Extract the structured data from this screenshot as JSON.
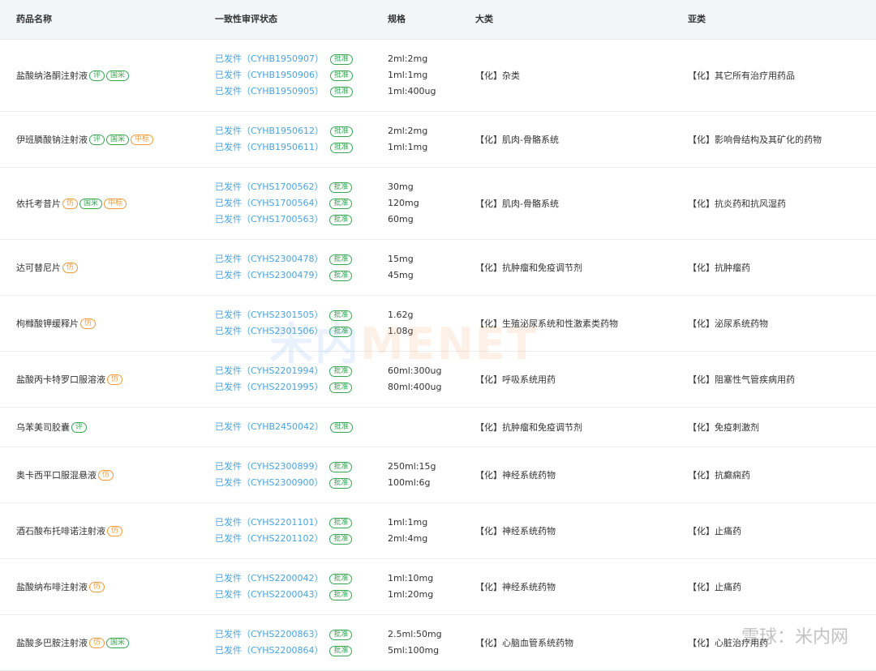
{
  "headers": {
    "name": "药品名称",
    "status": "一致性审评状态",
    "spec": "规格",
    "category": "大类",
    "subcategory": "亚类"
  },
  "rows": [
    {
      "name": "盐酸纳洛酮注射液",
      "tags": [
        {
          "text": "评",
          "color": "green"
        },
        {
          "text": "国采",
          "color": "green"
        }
      ],
      "statuses": [
        "已发件（CYHB1950907）",
        "已发件（CYHB1950906）",
        "已发件（CYHB1950905）"
      ],
      "specs": [
        "2ml:2mg",
        "1ml:1mg",
        "1ml:400ug"
      ],
      "category": "【化】杂类",
      "subcategory": "【化】其它所有治疗用药品"
    },
    {
      "name": "伊班膦酸钠注射液",
      "tags": [
        {
          "text": "评",
          "color": "green"
        },
        {
          "text": "国采",
          "color": "green"
        },
        {
          "text": "中标",
          "color": "orange"
        }
      ],
      "statuses": [
        "已发件（CYHB1950612）",
        "已发件（CYHB1950611）"
      ],
      "specs": [
        "2ml:2mg",
        "1ml:1mg"
      ],
      "category": "【化】肌肉-骨骼系统",
      "subcategory": "【化】影响骨结构及其矿化的药物"
    },
    {
      "name": "依托考昔片",
      "tags": [
        {
          "text": "仿",
          "color": "orange"
        },
        {
          "text": "国采",
          "color": "green"
        },
        {
          "text": "中标",
          "color": "orange"
        }
      ],
      "statuses": [
        "已发件（CYHS1700562）",
        "已发件（CYHS1700564）",
        "已发件（CYHS1700563）"
      ],
      "specs": [
        "30mg",
        "120mg",
        "60mg"
      ],
      "category": "【化】肌肉-骨骼系统",
      "subcategory": "【化】抗炎药和抗风湿药"
    },
    {
      "name": "达可替尼片",
      "tags": [
        {
          "text": "仿",
          "color": "orange"
        }
      ],
      "statuses": [
        "已发件（CYHS2300478）",
        "已发件（CYHS2300479）"
      ],
      "specs": [
        "15mg",
        "45mg"
      ],
      "category": "【化】抗肿瘤和免疫调节剂",
      "subcategory": "【化】抗肿瘤药"
    },
    {
      "name": "枸橼酸钾缓释片",
      "tags": [
        {
          "text": "仿",
          "color": "orange"
        }
      ],
      "statuses": [
        "已发件（CYHS2301505）",
        "已发件（CYHS2301506）"
      ],
      "specs": [
        "1.62g",
        "1.08g"
      ],
      "category": "【化】生殖泌尿系统和性激素类药物",
      "subcategory": "【化】泌尿系统药物"
    },
    {
      "name": "盐酸丙卡特罗口服溶液",
      "tags": [
        {
          "text": "仿",
          "color": "orange"
        }
      ],
      "statuses": [
        "已发件（CYHS2201994）",
        "已发件（CYHS2201995）"
      ],
      "specs": [
        "60ml:300ug",
        "80ml:400ug"
      ],
      "category": "【化】呼吸系统用药",
      "subcategory": "【化】阻塞性气管疾病用药"
    },
    {
      "name": "乌苯美司胶囊",
      "tags": [
        {
          "text": "评",
          "color": "green"
        }
      ],
      "statuses": [
        "已发件（CYHB2450042）"
      ],
      "specs": [],
      "category": "【化】抗肿瘤和免疫调节剂",
      "subcategory": "【化】免疫刺激剂"
    },
    {
      "name": "奥卡西平口服混悬液",
      "tags": [
        {
          "text": "仿",
          "color": "orange"
        }
      ],
      "statuses": [
        "已发件（CYHS2300899）",
        "已发件（CYHS2300900）"
      ],
      "specs": [
        "250ml:15g",
        "100ml:6g"
      ],
      "category": "【化】神经系统药物",
      "subcategory": "【化】抗癫痫药"
    },
    {
      "name": "酒石酸布托啡诺注射液",
      "tags": [
        {
          "text": "仿",
          "color": "orange"
        }
      ],
      "statuses": [
        "已发件（CYHS2201101）",
        "已发件（CYHS2201102）"
      ],
      "specs": [
        "1ml:1mg",
        "2ml:4mg"
      ],
      "category": "【化】神经系统药物",
      "subcategory": "【化】止痛药"
    },
    {
      "name": "盐酸纳布啡注射液",
      "tags": [
        {
          "text": "仿",
          "color": "orange"
        }
      ],
      "statuses": [
        "已发件（CYHS2200042）",
        "已发件（CYHS2200043）"
      ],
      "specs": [
        "1ml:10mg",
        "1ml:20mg"
      ],
      "category": "【化】神经系统药物",
      "subcategory": "【化】止痛药"
    },
    {
      "name": "盐酸多巴胺注射液",
      "tags": [
        {
          "text": "仿",
          "color": "orange"
        },
        {
          "text": "国采",
          "color": "green"
        }
      ],
      "statuses": [
        "已发件（CYHS2200863）",
        "已发件（CYHS2200864）"
      ],
      "specs": [
        "2.5ml:50mg",
        "5ml:100mg"
      ],
      "category": "【化】心脑血管系统药物",
      "subcategory": "【化】心脏治疗用药"
    }
  ],
  "approve_label": "批准",
  "watermark": {
    "cn": "米内",
    "en": "MENET"
  },
  "corner_watermark": "雪球：米内网",
  "colors": {
    "link": "#4aa3df",
    "green_tag": "#3aa655",
    "orange_tag": "#f09a3a",
    "header_bg": "#f3f6f9"
  }
}
